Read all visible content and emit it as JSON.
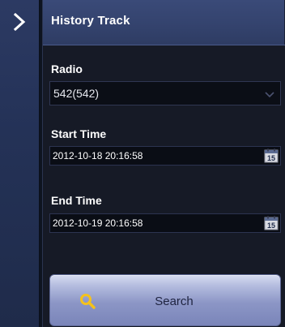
{
  "panel": {
    "title": "History Track"
  },
  "radio": {
    "label": "Radio",
    "selected": "542(542)"
  },
  "start_time": {
    "label": "Start Time",
    "value": "2012-10-18 20:16:58",
    "calendar_icon_text": "15"
  },
  "end_time": {
    "label": "End Time",
    "value": "2012-10-19 20:16:58",
    "calendar_icon_text": "15"
  },
  "search": {
    "label": "Search"
  },
  "icons": {
    "collapse": "chevron-right-icon",
    "dropdown": "chevron-down-icon",
    "calendar": "calendar-icon",
    "search": "magnifier-icon"
  },
  "colors": {
    "header": "#34436e",
    "accent_icon": "#f5c21b",
    "button_top": "#d7dcf0",
    "button_bottom": "#7a85b9"
  }
}
